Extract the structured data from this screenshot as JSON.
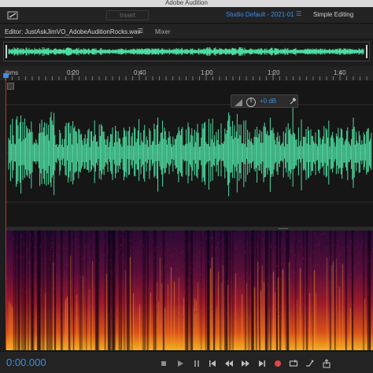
{
  "app": {
    "title": "Adobe Audition"
  },
  "toolbar": {
    "invert_label": "Invert",
    "workspace_label": "Studio Default - 2021-01",
    "workspace_menu_icon": "hamburger-icon",
    "simple_editing_label": "Simple Editing"
  },
  "tabs": {
    "editor_label": "Editor: JustAskJimVO_AdobeAuditionRocks.wav",
    "editor_menu_icon": "hamburger-icon",
    "mixer_label": "Mixer"
  },
  "ruler": {
    "unit_label": "hms",
    "ticks": [
      "0:20",
      "0:40",
      "1:00",
      "1:20",
      "1:40"
    ]
  },
  "hud": {
    "volume_label": "+0 dB"
  },
  "transport": {
    "time": "0:00.000"
  },
  "colors": {
    "waveform": "#4fdba0",
    "accent": "#3d8ee6",
    "playhead": "#b03a3a",
    "record": "#e04848"
  }
}
